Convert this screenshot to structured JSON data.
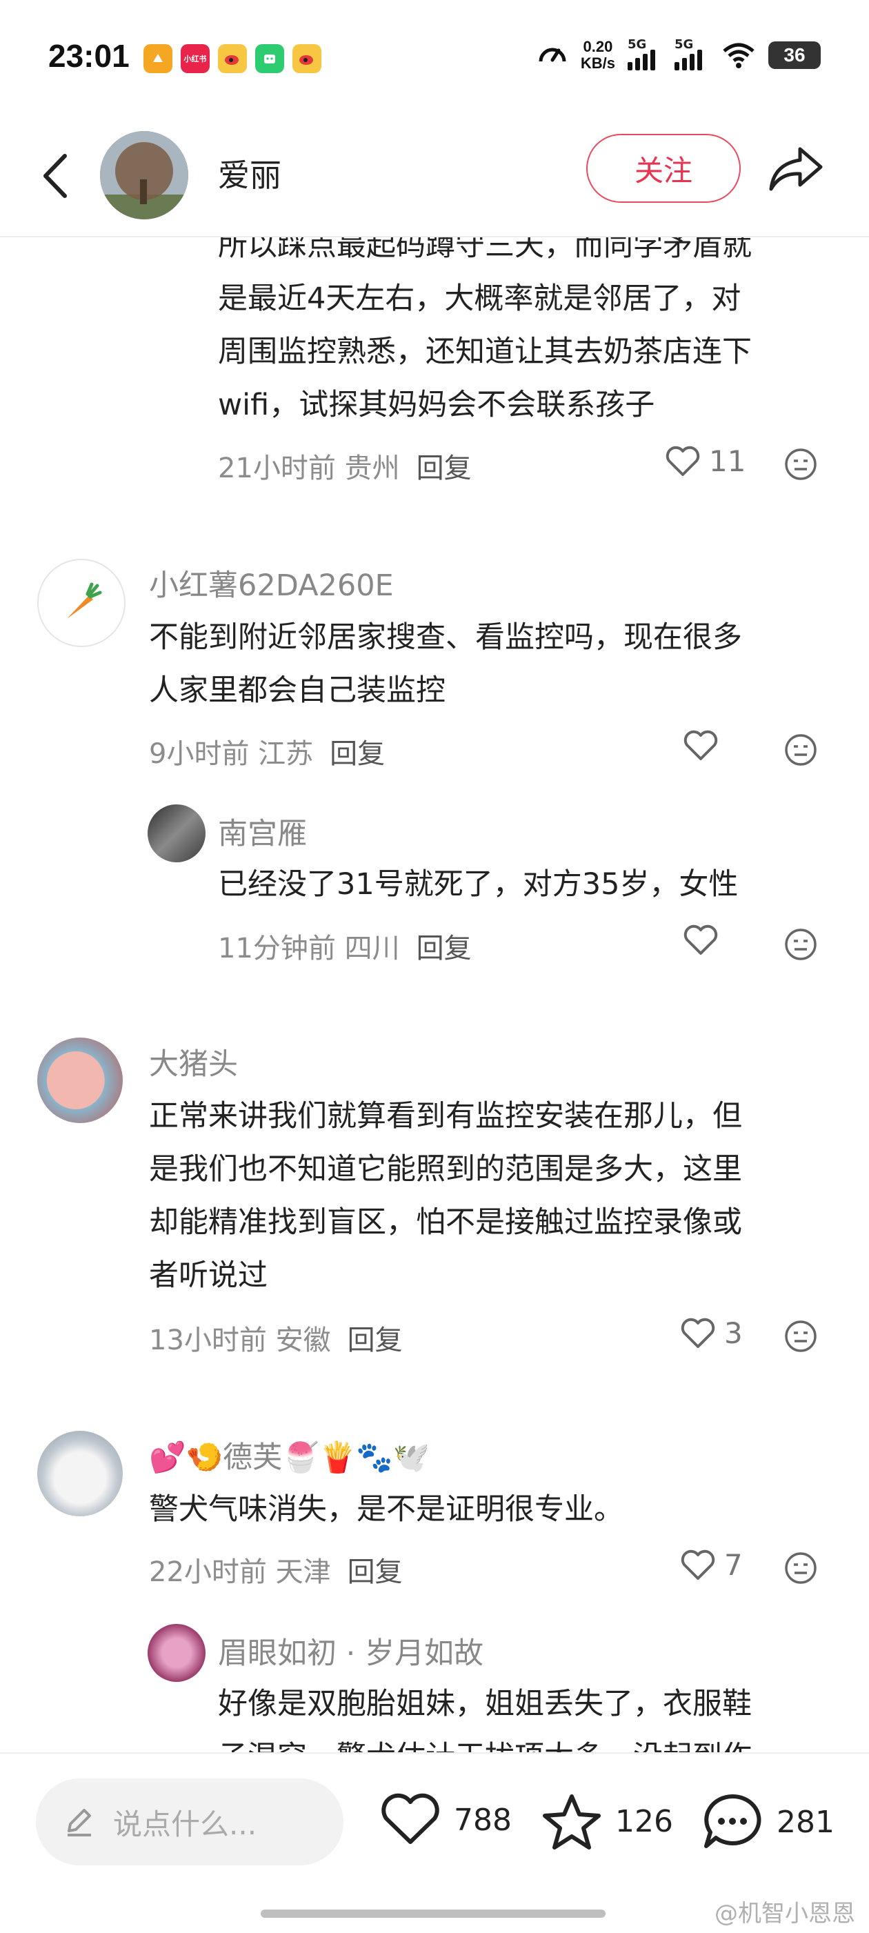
{
  "status_bar": {
    "time": "23:01",
    "speed_value": "0.20",
    "speed_unit": "KB/s",
    "signal1": "5G",
    "signal2": "5G",
    "battery": "36",
    "app_icons": [
      {
        "name": "app-orange-icon",
        "color": "#f5a623",
        "text": ""
      },
      {
        "name": "app-red-icon",
        "color": "#e8244a",
        "text": "小红书"
      },
      {
        "name": "app-weibo-icon",
        "color": "#f7c744",
        "text": ""
      },
      {
        "name": "app-green-icon",
        "color": "#2ecc71",
        "text": ""
      },
      {
        "name": "app-weibo2-icon",
        "color": "#f7c744",
        "text": ""
      }
    ]
  },
  "header": {
    "name": "爱丽",
    "follow_label": "关注"
  },
  "comments": {
    "c0": {
      "lines": [
        "所以踩点最起码蹲守三天，而同学矛盾就",
        "是最近4天左右，大概率就是邻居了，对",
        "周围监控熟悉，还知道让其去奶茶店连下",
        "wifi，试探其妈妈会不会联系孩子"
      ],
      "meta": "21小时前 贵州",
      "reply": "回复",
      "likes": "11"
    },
    "c1": {
      "name": "小红薯62DA260E",
      "lines": [
        "不能到附近邻居家搜查、看监控吗，现在很多",
        "人家里都会自己装监控"
      ],
      "meta": "9小时前 江苏",
      "reply": "回复",
      "likes": ""
    },
    "c1r": {
      "name": "南宫雁",
      "lines": [
        "已经没了31号就死了，对方35岁，女性"
      ],
      "meta": "11分钟前 四川",
      "reply": "回复",
      "likes": ""
    },
    "c2": {
      "name": "大猪头",
      "lines": [
        "正常来讲我们就算看到有监控安装在那儿，但",
        "是我们也不知道它能照到的范围是多大，这里",
        "却能精准找到盲区，怕不是接触过监控录像或",
        "者听说过"
      ],
      "meta": "13小时前 安徽",
      "reply": "回复",
      "likes": "3"
    },
    "c3": {
      "name": "💕🍤德芙🍧🍟🐾🕊️",
      "lines": [
        "警犬气味消失，是不是证明很专业。"
      ],
      "meta": "22小时前 天津",
      "reply": "回复",
      "likes": "7"
    },
    "c3r": {
      "name": "眉眼如初 · 岁月如故",
      "lines": [
        "好像是双胞胎姐妹，姐姐丢失了，衣服鞋",
        "子混穿，警犬估计干扰项太多，没起到作"
      ]
    }
  },
  "bottom": {
    "placeholder": "说点什么...",
    "likes": "788",
    "stars": "126",
    "comments": "281"
  },
  "watermark": "@机智小恩恩",
  "colors": {
    "accent_red": "#e8344e",
    "text_gray": "#8c8c8c"
  }
}
